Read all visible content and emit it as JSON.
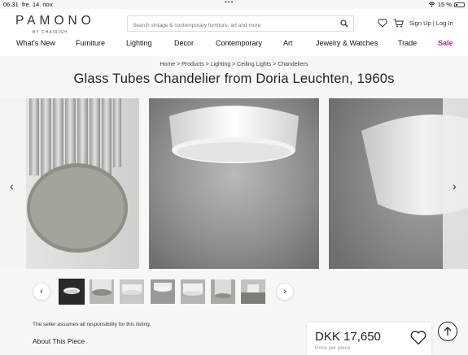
{
  "statusbar": {
    "time": "06.31",
    "date": "fre. 14. nov.",
    "dots": "•••",
    "battery": "15 %"
  },
  "header": {
    "logo": "PAMONO",
    "logo_sub": "BY CHAIRISH",
    "search_placeholder": "Search vintage & contemporary furniture, art and more",
    "account": "Sign Up | Log In"
  },
  "nav": {
    "items": [
      {
        "label": "What's New"
      },
      {
        "label": "Furniture"
      },
      {
        "label": "Lighting"
      },
      {
        "label": "Decor"
      },
      {
        "label": "Contemporary"
      },
      {
        "label": "Art"
      },
      {
        "label": "Jewelry & Watches"
      },
      {
        "label": "Trade"
      },
      {
        "label": "Sale"
      }
    ]
  },
  "breadcrumb": "Home > Products > Lighting > Ceiling Lights > Chandeliers",
  "product": {
    "title": "Glass Tubes Chandelier from Doria Leuchten, 1960s",
    "seller_note": "The seller assumes all responsibility for this listing.",
    "about": "About This Piece",
    "price": "DKK 17,650",
    "price_sub": "Price per piece"
  },
  "gallery": {
    "prev": "‹",
    "next": "›",
    "thumb_count": 7,
    "selected_thumb": 1
  },
  "colors": {
    "sale": "#c41ba1",
    "background": "#f7f7f7"
  }
}
